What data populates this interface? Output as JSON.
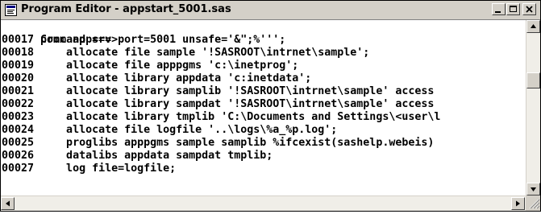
{
  "window": {
    "title": "Program Editor - appstart_5001.sas",
    "icon": "program-editor-icon",
    "buttons": [
      "minimize-icon",
      "maximize-icon",
      "close-icon"
    ]
  },
  "editor": {
    "command_prompt": "Command ===>",
    "lines": [
      {
        "num": "00017",
        "code": " proc appsrv port=5001 unsafe='&\";%''';"
      },
      {
        "num": "00018",
        "code": "     allocate file sample '!SASROOT\\intrnet\\sample';"
      },
      {
        "num": "00019",
        "code": "     allocate file apppgms 'c:\\inetprog';"
      },
      {
        "num": "00020",
        "code": "     allocate library appdata 'c:inetdata';"
      },
      {
        "num": "00021",
        "code": "     allocate library samplib '!SASROOT\\intrnet\\sample' access"
      },
      {
        "num": "00022",
        "code": "     allocate library sampdat '!SASROOT\\intrnet\\sample' access"
      },
      {
        "num": "00023",
        "code": "     allocate library tmplib 'C:\\Documents and Settings\\<user\\l"
      },
      {
        "num": "00024",
        "code": "     allocate file logfile '..\\logs\\%a_%p.log';"
      },
      {
        "num": "00025",
        "code": "     proglibs apppgms sample samplib %ifcexist(sashelp.webeis)"
      },
      {
        "num": "00026",
        "code": "     datalibs appdata sampdat tmplib;"
      },
      {
        "num": "00027",
        "code": "     log file=logfile;"
      }
    ]
  },
  "colors": {
    "titlebar_bg": "#d4d0c8",
    "editor_bg": "#ffffff",
    "text": "#000000"
  }
}
